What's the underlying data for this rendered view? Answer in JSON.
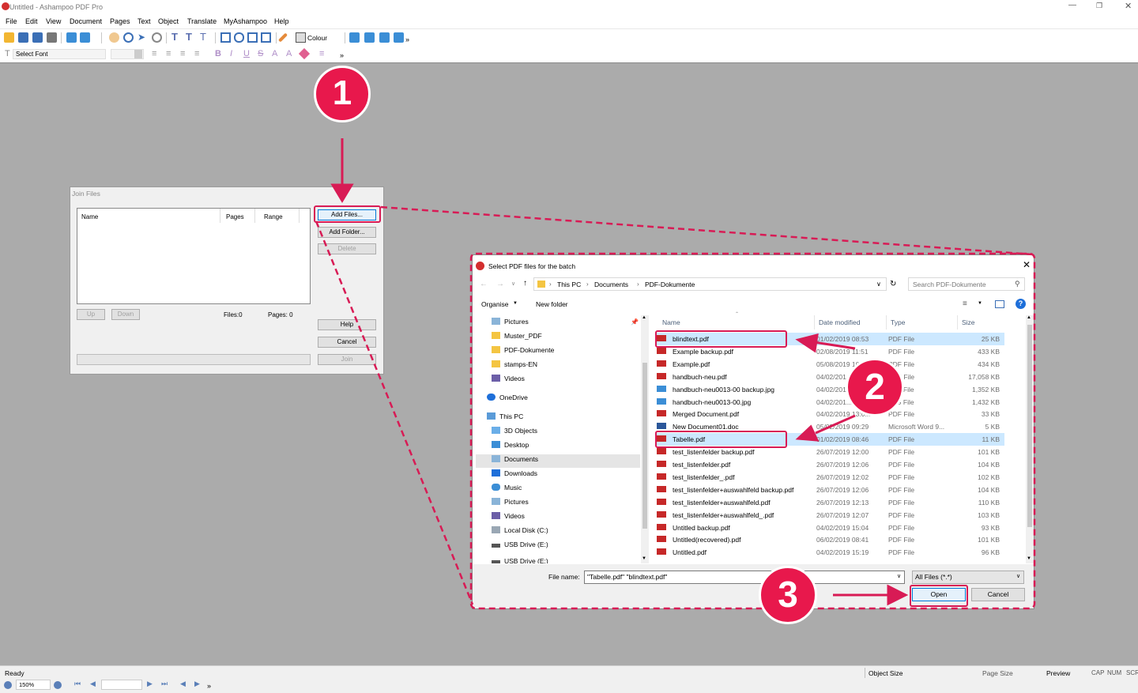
{
  "app": {
    "title": "Untitled - Ashampoo PDF Pro",
    "menu": [
      "File",
      "Edit",
      "View",
      "Document",
      "Pages",
      "Text",
      "Object",
      "Translate",
      "MyAshampoo",
      "Help"
    ],
    "colour_label": "Colour",
    "font_placeholder": "Select Font"
  },
  "join_dialog": {
    "title": "Join Files",
    "columns": [
      "Name",
      "Pages",
      "Range"
    ],
    "add_files": "Add Files...",
    "add_folder": "Add Folder...",
    "delete": "Delete",
    "up": "Up",
    "down": "Down",
    "files_count": "Files:0",
    "pages_count": "Pages: 0",
    "help": "Help",
    "cancel": "Cancel",
    "join": "Join"
  },
  "file_dialog": {
    "title": "Select PDF files for the batch",
    "breadcrumb": [
      "This PC",
      "Documents",
      "PDF-Dokumente"
    ],
    "search_placeholder": "Search PDF-Dokumente",
    "organise": "Organise",
    "new_folder": "New folder",
    "sidebar": [
      {
        "label": "Pictures",
        "icon": "pictures-icon"
      },
      {
        "label": "Muster_PDF",
        "icon": "folder-icon"
      },
      {
        "label": "PDF-Dokumente",
        "icon": "folder-icon"
      },
      {
        "label": "stamps-EN",
        "icon": "folder-icon"
      },
      {
        "label": "Videos",
        "icon": "videos-icon"
      },
      {
        "label": "OneDrive",
        "icon": "onedrive-icon"
      },
      {
        "label": "This PC",
        "icon": "computer-icon"
      },
      {
        "label": "3D Objects",
        "icon": "3d-objects-icon"
      },
      {
        "label": "Desktop",
        "icon": "desktop-icon"
      },
      {
        "label": "Documents",
        "icon": "documents-icon"
      },
      {
        "label": "Downloads",
        "icon": "downloads-icon"
      },
      {
        "label": "Music",
        "icon": "music-icon"
      },
      {
        "label": "Pictures",
        "icon": "pictures-icon"
      },
      {
        "label": "Videos",
        "icon": "videos-icon"
      },
      {
        "label": "Local Disk (C:)",
        "icon": "disk-icon"
      },
      {
        "label": "USB Drive (E:)",
        "icon": "usb-icon"
      },
      {
        "label": "USB Drive (E:)",
        "icon": "usb-icon"
      }
    ],
    "columns": [
      "Name",
      "Date modified",
      "Type",
      "Size"
    ],
    "files": [
      {
        "name": "blindtext.pdf",
        "date": "01/02/2019 08:53",
        "type": "PDF File",
        "size": "25 KB",
        "selected": true,
        "icon": "pdf"
      },
      {
        "name": "Example backup.pdf",
        "date": "02/08/2019 11:51",
        "type": "PDF File",
        "size": "433 KB",
        "icon": "pdf"
      },
      {
        "name": "Example.pdf",
        "date": "05/08/2019 10:...",
        "type": "PDF File",
        "size": "434 KB",
        "icon": "pdf"
      },
      {
        "name": "handbuch-neu.pdf",
        "date": "04/02/201...",
        "type": "PDF File",
        "size": "17,058 KB",
        "icon": "pdf"
      },
      {
        "name": "handbuch-neu0013-00 backup.jpg",
        "date": "04/02/201...",
        "type": "JPG File",
        "size": "1,352 KB",
        "icon": "img"
      },
      {
        "name": "handbuch-neu0013-00.jpg",
        "date": "04/02/201...",
        "type": "JPG File",
        "size": "1,432 KB",
        "icon": "img"
      },
      {
        "name": "Merged Document.pdf",
        "date": "04/02/2019 13:0...",
        "type": "PDF File",
        "size": "33 KB",
        "icon": "pdf"
      },
      {
        "name": "New Document01.doc",
        "date": "05/02/2019 09:29",
        "type": "Microsoft Word 9...",
        "size": "5 KB",
        "icon": "doc"
      },
      {
        "name": "Tabelle.pdf",
        "date": "01/02/2019 08:46",
        "type": "PDF File",
        "size": "11 KB",
        "selected": true,
        "icon": "pdf"
      },
      {
        "name": "test_listenfelder backup.pdf",
        "date": "26/07/2019 12:00",
        "type": "PDF File",
        "size": "101 KB",
        "icon": "pdf"
      },
      {
        "name": "test_listenfelder.pdf",
        "date": "26/07/2019 12:06",
        "type": "PDF File",
        "size": "104 KB",
        "icon": "pdf"
      },
      {
        "name": "test_listenfelder_.pdf",
        "date": "26/07/2019 12:02",
        "type": "PDF File",
        "size": "102 KB",
        "icon": "pdf"
      },
      {
        "name": "test_listenfelder+auswahlfeld backup.pdf",
        "date": "26/07/2019 12:06",
        "type": "PDF File",
        "size": "104 KB",
        "icon": "pdf"
      },
      {
        "name": "test_listenfelder+auswahlfeld.pdf",
        "date": "26/07/2019 12:13",
        "type": "PDF File",
        "size": "110 KB",
        "icon": "pdf"
      },
      {
        "name": "test_listenfelder+auswahlfeld_.pdf",
        "date": "26/07/2019 12:07",
        "type": "PDF File",
        "size": "103 KB",
        "icon": "pdf"
      },
      {
        "name": "Untitled backup.pdf",
        "date": "04/02/2019 15:04",
        "type": "PDF File",
        "size": "93 KB",
        "icon": "pdf"
      },
      {
        "name": "Untitled(recovered).pdf",
        "date": "06/02/2019 08:41",
        "type": "PDF File",
        "size": "101 KB",
        "icon": "pdf"
      },
      {
        "name": "Untitled.pdf",
        "date": "04/02/2019 15:19",
        "type": "PDF File",
        "size": "96 KB",
        "icon": "pdf"
      }
    ],
    "file_name_label": "File name:",
    "file_name_value": "\"Tabelle.pdf\" \"blindtext.pdf\"",
    "filter": "All Files (*.*)",
    "open": "Open",
    "cancel": "Cancel"
  },
  "callouts": [
    "1",
    "2",
    "3"
  ],
  "status": {
    "ready": "Ready",
    "object_size": "Object Size",
    "page_size": "Page Size",
    "preview": "Preview",
    "cap": "CAP",
    "num": "NUM",
    "scr": "SCR",
    "zoom": "150%"
  },
  "colors": {
    "accent": "#e8184c",
    "selection": "#cce8ff",
    "highlight_box": "#d81b55"
  }
}
